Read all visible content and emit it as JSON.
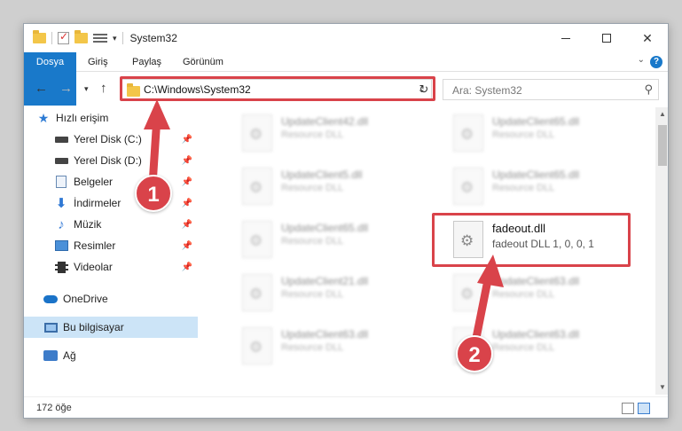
{
  "window": {
    "title": "System32",
    "minimize_icon": "minimize-icon",
    "maximize_icon": "maximize-icon",
    "close_glyph": "✕"
  },
  "ribbon": {
    "tabs": [
      {
        "label": "Dosya"
      },
      {
        "label": "Giriş"
      },
      {
        "label": "Paylaş"
      },
      {
        "label": "Görünüm"
      }
    ],
    "help_glyph": "?"
  },
  "address": {
    "path": "C:\\Windows\\System32",
    "search_placeholder": "Ara: System32"
  },
  "nav": {
    "items": [
      {
        "label": "Hızlı erişim",
        "icon": "star-icon"
      },
      {
        "label": "Yerel Disk (C:)",
        "icon": "drive-icon"
      },
      {
        "label": "Yerel Disk (D:)",
        "icon": "drive-icon"
      },
      {
        "label": "Belgeler",
        "icon": "document-icon"
      },
      {
        "label": "İndirmeler",
        "icon": "download-icon"
      },
      {
        "label": "Müzik",
        "icon": "music-icon"
      },
      {
        "label": "Resimler",
        "icon": "pictures-icon"
      },
      {
        "label": "Videolar",
        "icon": "videos-icon"
      },
      {
        "label": "OneDrive",
        "icon": "cloud-icon"
      },
      {
        "label": "Bu bilgisayar",
        "icon": "computer-icon"
      },
      {
        "label": "Ağ",
        "icon": "network-icon"
      }
    ]
  },
  "files": {
    "left": [
      {
        "name": "UpdateClient42.dll",
        "desc": "Resource DLL"
      },
      {
        "name": "UpdateClient5.dll",
        "desc": "Resource DLL"
      },
      {
        "name": "UpdateClient65.dll",
        "desc": "Resource DLL"
      },
      {
        "name": "UpdateClient21.dll",
        "desc": "Resource DLL"
      },
      {
        "name": "UpdateClient63.dll",
        "desc": "Resource DLL"
      }
    ],
    "right": [
      {
        "name": "UpdateClient65.dll",
        "desc": "Resource DLL"
      },
      {
        "name": "UpdateClient65.dll",
        "desc": "Resource DLL"
      },
      {
        "name": "fadeout.dll",
        "desc": "fadeout DLL 1, 0, 0, 1"
      },
      {
        "name": "UpdateClient63.dll",
        "desc": "Resource DLL"
      },
      {
        "name": "UpdateClient63.dll",
        "desc": "Resource DLL"
      }
    ]
  },
  "status": {
    "count": "172 öğe"
  },
  "annotations": {
    "step1": "1",
    "step2": "2",
    "accent": "#d9434a"
  },
  "colors": {
    "file_tab": "#1979ca",
    "selected_nav": "#cce4f7"
  }
}
